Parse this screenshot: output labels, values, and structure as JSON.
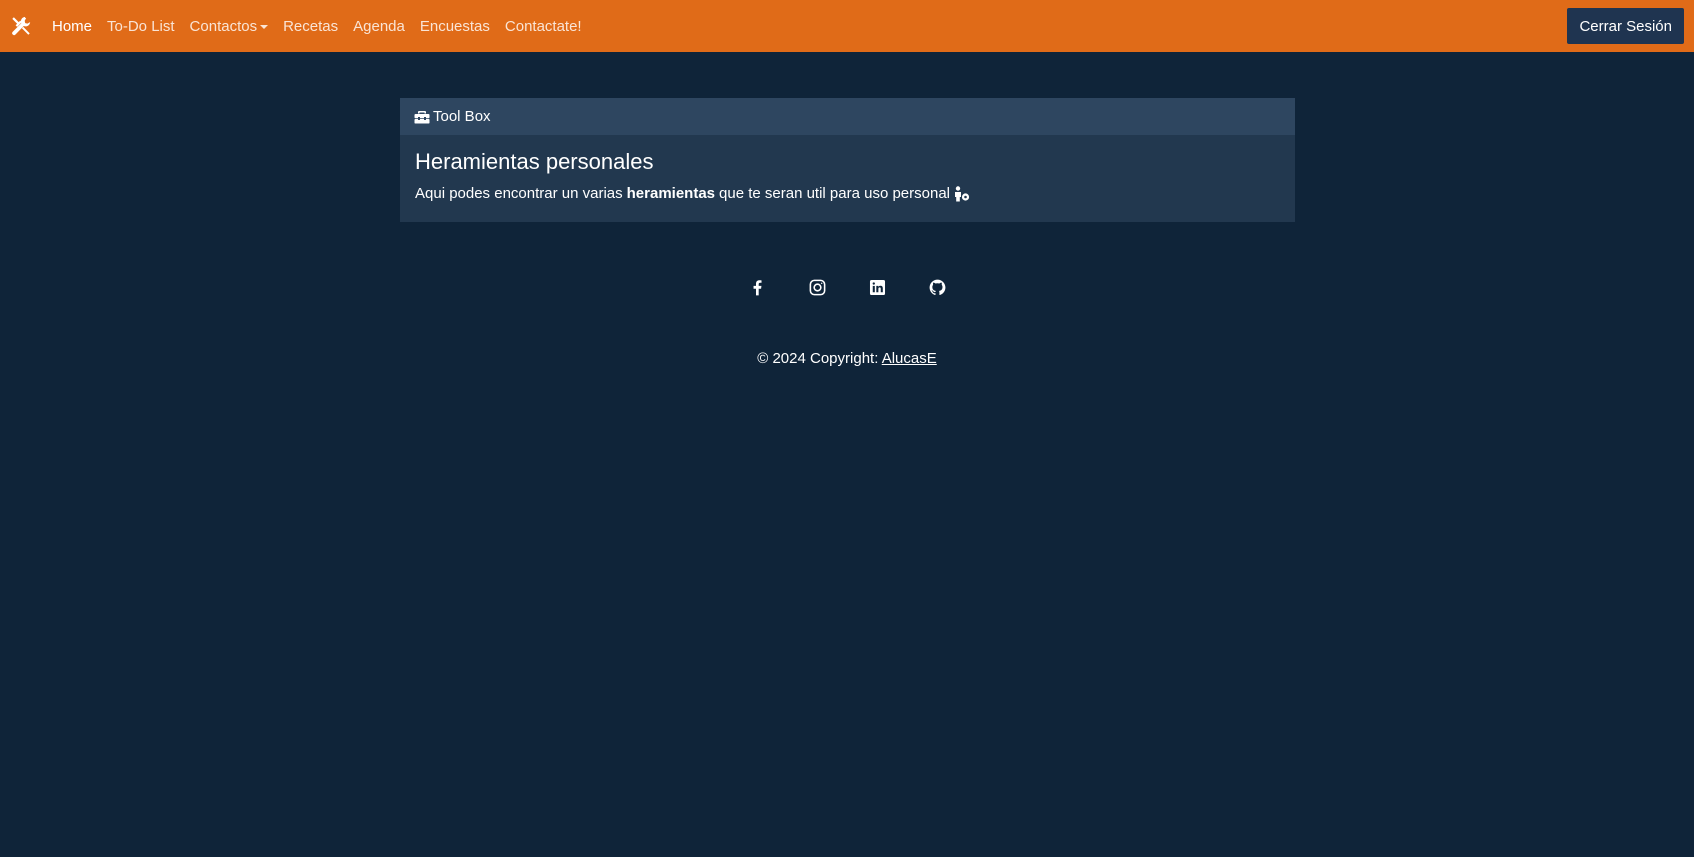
{
  "navbar": {
    "brand_icon": "tools-icon",
    "links": [
      {
        "label": "Home"
      },
      {
        "label": "To-Do List"
      },
      {
        "label": "Contactos"
      },
      {
        "label": "Recetas"
      },
      {
        "label": "Agenda"
      },
      {
        "label": "Encuestas"
      },
      {
        "label": "Contactate!"
      }
    ],
    "logout_label": "Cerrar Sesión",
    "colors": {
      "background": "#e06b18",
      "logout_bg": "#1f3450"
    }
  },
  "card": {
    "header_icon": "toolbox-icon",
    "header_title": "Tool Box",
    "title": "Heramientas personales",
    "text_before": "Aqui podes encontrar un varias",
    "text_bold": "heramientas",
    "text_after": "que te seran util para uso personal",
    "text_icon": "user-gear-icon"
  },
  "social": [
    {
      "name": "facebook-icon"
    },
    {
      "name": "instagram-icon"
    },
    {
      "name": "linkedin-icon"
    },
    {
      "name": "github-icon"
    }
  ],
  "footer": {
    "copyright": "© 2024 Copyright:",
    "author": "AlucasE"
  },
  "colors": {
    "page_background": "#0f2439",
    "card_background": "#22384f",
    "card_header_background": "#2e4660"
  }
}
